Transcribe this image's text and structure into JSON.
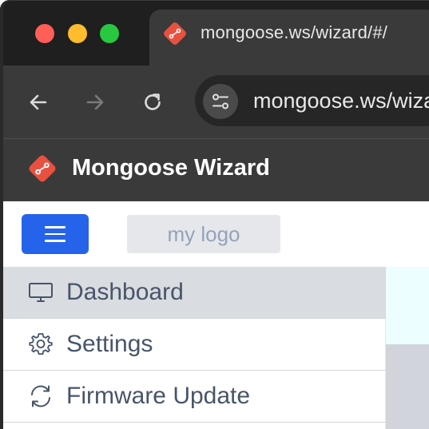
{
  "browser": {
    "tab": {
      "title": "mongoose.ws/wizard/#/",
      "favicon": "mongoose-diamond-icon"
    },
    "toolbar": {
      "back_icon": "arrow-left-icon",
      "forward_icon": "arrow-right-icon",
      "reload_icon": "reload-icon",
      "site_info_icon": "site-settings-icon",
      "url": "mongoose.ws/wizard/#/"
    },
    "traffic_lights": [
      "close",
      "minimize",
      "maximize"
    ]
  },
  "app": {
    "title": "Mongoose Wizard",
    "logo_placeholder": "my logo",
    "accent_color": "#2563eb",
    "brand_color": "#e8513f"
  },
  "sidebar": {
    "items": [
      {
        "label": "Dashboard",
        "icon": "monitor-icon",
        "active": true
      },
      {
        "label": "Settings",
        "icon": "gear-icon",
        "active": false
      },
      {
        "label": "Firmware Update",
        "icon": "refresh-icon",
        "active": false
      }
    ]
  }
}
